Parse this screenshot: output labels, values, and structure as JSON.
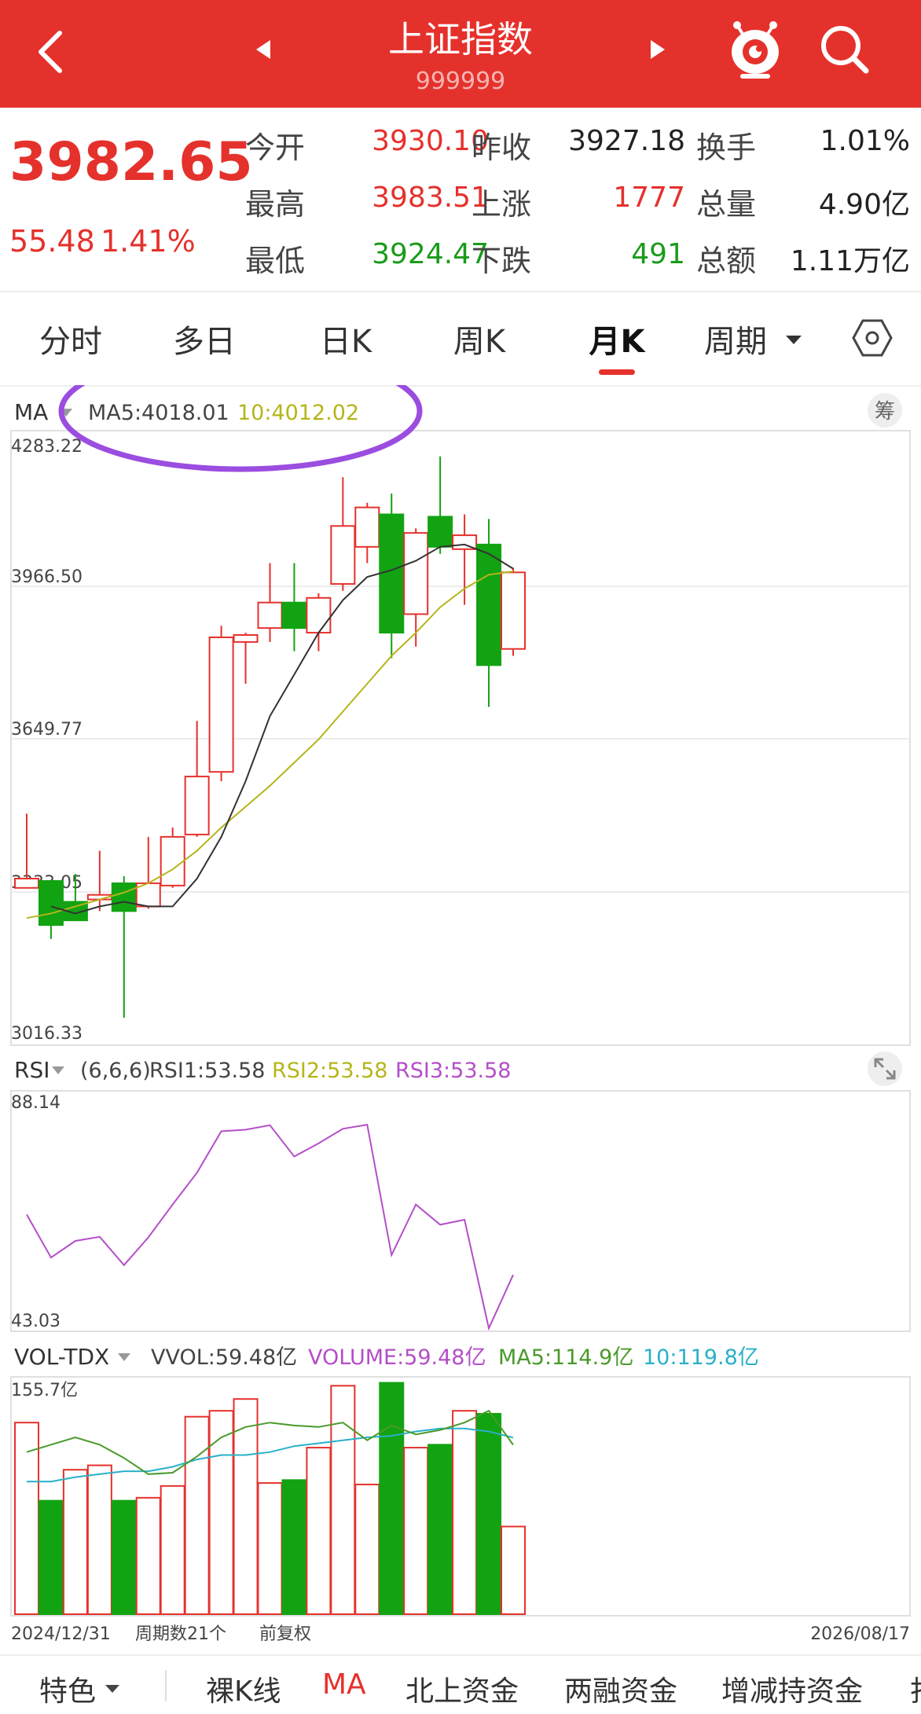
{
  "header": {
    "title": "上证指数",
    "code": "999999"
  },
  "quote": {
    "price": "3982.65",
    "change": "55.48",
    "change_pct": "1.41%",
    "fields": [
      {
        "label": "今开",
        "value": "3930.10",
        "color": "#e5312c"
      },
      {
        "label": "昨收",
        "value": "3927.18",
        "color": "#222222"
      },
      {
        "label": "换手",
        "value": "1.01%",
        "color": "#222222"
      },
      {
        "label": "最高",
        "value": "3983.51",
        "color": "#e5312c"
      },
      {
        "label": "上涨",
        "value": "1777",
        "color": "#e5312c"
      },
      {
        "label": "总量",
        "value": "4.90亿",
        "color": "#222222"
      },
      {
        "label": "最低",
        "value": "3924.47",
        "color": "#1a9b1a"
      },
      {
        "label": "下跌",
        "value": "491",
        "color": "#1a9b1a"
      },
      {
        "label": "总额",
        "value": "1.11万亿",
        "color": "#222222"
      }
    ]
  },
  "tabs": [
    "分时",
    "多日",
    "日K",
    "周K",
    "月K",
    "周期"
  ],
  "active_tab": "月K",
  "ma_panel": {
    "selector": "MA",
    "ma5_label": "MA5:4018.01",
    "ma10_label": "10:4012.02",
    "chip_label": "筹"
  },
  "rsi_panel": {
    "selector": "RSI",
    "params": "(6,6,6)",
    "rsi1_label": "RSI1:53.58",
    "rsi2_label": "RSI2:53.58",
    "rsi3_label": "RSI3:53.58"
  },
  "vol_panel": {
    "selector": "VOL-TDX",
    "vvol_label": "VVOL:59.48亿",
    "volume_label": "VOLUME:59.48亿",
    "ma5_label": "MA5:114.9亿",
    "ma10_label": "10:119.8亿"
  },
  "footer_info": {
    "start_date": "2024/12/31",
    "period_count": "周期数21个",
    "adjust": "前复权",
    "end_date": "2026/08/17"
  },
  "bottom_bar": [
    "特色",
    "裸K线",
    "MA",
    "北上资金",
    "两融资金",
    "增减持资金",
    "打"
  ],
  "colors": {
    "up": "#e5312c",
    "down": "#12a312",
    "ma5": "#333333",
    "ma10": "#b5b51a",
    "rsi": "#b44ec8",
    "vol_ma5": "#4a9a2a",
    "vol_ma10": "#29b0c8",
    "highlight_oval": "#9b4de0"
  },
  "chart_data": [
    {
      "type": "candlestick",
      "title": "",
      "y_tick_labels": [
        "4283.22",
        "3966.50",
        "3649.77",
        "3333.05",
        "3016.33"
      ],
      "ylim": [
        3016.33,
        4283.22
      ],
      "candles": [
        {
          "open": 3330,
          "close": 3350,
          "high": 3490,
          "low": 3330
        },
        {
          "open": 3345,
          "close": 3250,
          "high": 3345,
          "low": 3220
        },
        {
          "open": 3300,
          "close": 3260,
          "high": 3360,
          "low": 3260
        },
        {
          "open": 3305,
          "close": 3315,
          "high": 3410,
          "low": 3280
        },
        {
          "open": 3340,
          "close": 3280,
          "high": 3355,
          "low": 3050
        },
        {
          "open": 3290,
          "close": 3340,
          "high": 3440,
          "low": 3285
        },
        {
          "open": 3335,
          "close": 3440,
          "high": 3460,
          "low": 3330
        },
        {
          "open": 3445,
          "close": 3570,
          "high": 3690,
          "low": 3440
        },
        {
          "open": 3580,
          "close": 3870,
          "high": 3895,
          "low": 3560
        },
        {
          "open": 3860,
          "close": 3875,
          "high": 3880,
          "low": 3770
        },
        {
          "open": 3890,
          "close": 3945,
          "high": 4030,
          "low": 3860
        },
        {
          "open": 3945,
          "close": 3890,
          "high": 4030,
          "low": 3840
        },
        {
          "open": 3880,
          "close": 3955,
          "high": 3965,
          "low": 3840
        },
        {
          "open": 3985,
          "close": 4110,
          "high": 4215,
          "low": 3970
        },
        {
          "open": 4065,
          "close": 4150,
          "high": 4160,
          "low": 4030
        },
        {
          "open": 4135,
          "close": 3880,
          "high": 4180,
          "low": 3825
        },
        {
          "open": 3920,
          "close": 4095,
          "high": 4105,
          "low": 3850
        },
        {
          "open": 4130,
          "close": 4065,
          "high": 4260,
          "low": 4050
        },
        {
          "open": 4060,
          "close": 4090,
          "high": 4135,
          "low": 3940
        },
        {
          "open": 4070,
          "close": 3810,
          "high": 4125,
          "low": 3720
        },
        {
          "open": 3845,
          "close": 4010,
          "high": 4020,
          "low": 3830
        }
      ],
      "ma5": [
        null,
        3290,
        3275,
        3290,
        3300,
        3290,
        3290,
        3350,
        3440,
        3560,
        3700,
        3790,
        3880,
        3950,
        4000,
        4015,
        4035,
        4065,
        4070,
        4050,
        4018
      ],
      "ma10": [
        3265,
        3275,
        3290,
        3305,
        3320,
        3340,
        3370,
        3410,
        3460,
        3505,
        3550,
        3600,
        3650,
        3710,
        3770,
        3830,
        3880,
        3935,
        3975,
        4005,
        4012
      ]
    },
    {
      "type": "line",
      "title": "",
      "y_tick_labels": [
        "88.14",
        "43.03"
      ],
      "ylim": [
        43.03,
        88.14
      ],
      "series": [
        {
          "name": "RSI1",
          "values": [
            65.5,
            57.0,
            60.3,
            61.1,
            55.5,
            61.0,
            67.5,
            73.8,
            82.0,
            82.3,
            83.2,
            77.0,
            79.6,
            82.5,
            83.3,
            57.5,
            67.5,
            63.5,
            64.5,
            43.0,
            53.58
          ]
        }
      ]
    },
    {
      "type": "bar",
      "title": "",
      "y_tick_labels": [
        "155.7亿"
      ],
      "ylim": [
        0,
        155.7
      ],
      "values": [
        130,
        77,
        98,
        101,
        77,
        79,
        87,
        134,
        138,
        146,
        89,
        91,
        113,
        155,
        88,
        157,
        113,
        115,
        138,
        136,
        59.48
      ],
      "up": [
        true,
        false,
        true,
        true,
        false,
        true,
        true,
        true,
        true,
        true,
        true,
        false,
        true,
        true,
        true,
        false,
        true,
        false,
        true,
        false,
        true
      ],
      "series": [
        {
          "name": "MA5",
          "values": [
            110,
            115,
            120,
            115,
            106,
            95,
            96,
            107,
            120,
            127,
            130,
            128,
            127,
            130,
            118,
            128,
            122,
            125,
            130,
            138,
            114.9
          ]
        },
        {
          "name": "10",
          "values": [
            90,
            90,
            93,
            95,
            97,
            97,
            100,
            105,
            108,
            108,
            110,
            114,
            116,
            118,
            120,
            121,
            124,
            126,
            126,
            124,
            119.8
          ]
        }
      ]
    }
  ]
}
